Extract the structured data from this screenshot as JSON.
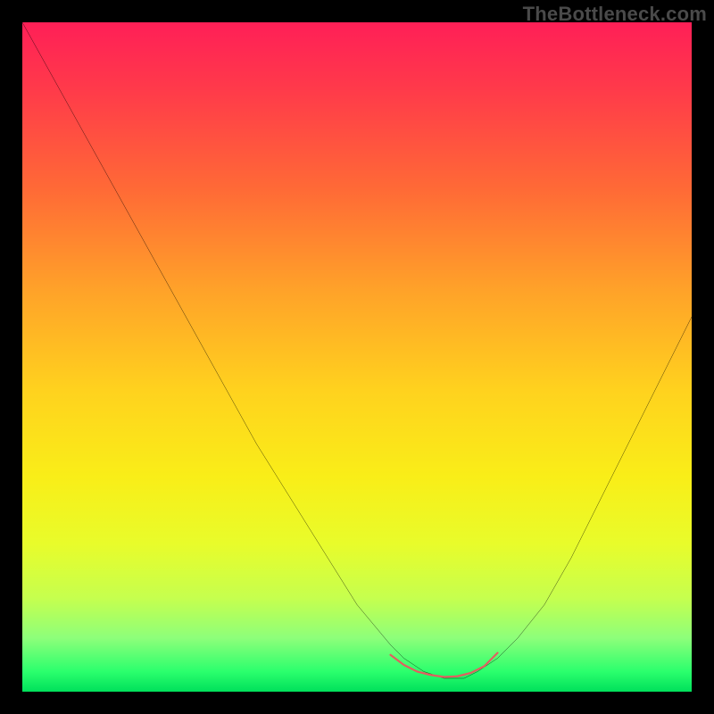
{
  "watermark": "TheBottleneck.com",
  "chart_data": {
    "type": "line",
    "title": "",
    "xlabel": "",
    "ylabel": "",
    "xlim": [
      0,
      100
    ],
    "ylim": [
      0,
      100
    ],
    "grid": false,
    "legend": false,
    "series": [
      {
        "name": "main-curve",
        "color": "#000000",
        "x": [
          0,
          5,
          10,
          15,
          20,
          25,
          30,
          35,
          40,
          45,
          50,
          55,
          57,
          60,
          63,
          66,
          68,
          71,
          74,
          78,
          82,
          86,
          90,
          94,
          98,
          100
        ],
        "y": [
          100,
          91,
          82,
          73,
          64,
          55,
          46,
          37,
          29,
          21,
          13,
          7,
          5,
          3,
          2,
          2,
          3,
          5,
          8,
          13,
          20,
          28,
          36,
          44,
          52,
          56
        ]
      },
      {
        "name": "highlight-band",
        "color": "#e06060",
        "x": [
          55,
          57,
          59,
          61,
          63,
          65,
          67,
          69,
          70,
          71
        ],
        "y": [
          5.5,
          4,
          3,
          2.5,
          2.2,
          2.3,
          2.8,
          3.8,
          4.8,
          5.8
        ]
      }
    ],
    "colormap": "rainbow-vertical"
  }
}
